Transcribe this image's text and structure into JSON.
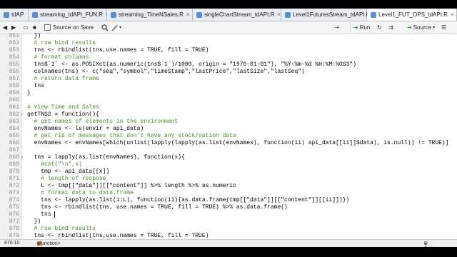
{
  "tabs": [
    {
      "label": "tdAPI.R",
      "active": false
    },
    {
      "label": "streaming_tdAPI_FUN.R",
      "active": false
    },
    {
      "label": "streaming_TimeNSales.R",
      "active": false
    },
    {
      "label": "singleChartStream_tdAPI.R",
      "active": false
    },
    {
      "label": "Level1FuturesStream_tdAPI.R",
      "active": false
    },
    {
      "label": "Level1_FUT_OPS_tdAPI.R",
      "active": true
    }
  ],
  "toolbar": {
    "source_on_save": "Source on Save",
    "run": "Run",
    "source": "Source"
  },
  "editor": {
    "lines": [
      {
        "num": "851",
        "text": "  })"
      },
      {
        "num": "852",
        "text": "  # row bind results"
      },
      {
        "num": "853",
        "text": "  tns <- rbindlist(tns,use.names = TRUE, fill = TRUE)"
      },
      {
        "num": "854",
        "text": "  # format columns"
      },
      {
        "num": "855",
        "text": "  tns$`1` <- as.POSIXct(as.numeric(tns$`1`)/1000, origin = \"1970-01-01\"), \"%Y-%m-%d %H:%M:%OS3\")"
      },
      {
        "num": "856",
        "text": "  colnames(tns) <- c(\"seq\",\"symbol\",\"timeStamp\",\"lastPrice\",\"lastSize\",\"lastSeq\")"
      },
      {
        "num": "857",
        "text": "  # return data frame"
      },
      {
        "num": "858",
        "text": "  tns"
      },
      {
        "num": "859",
        "text": "}"
      },
      {
        "num": "860",
        "text": ""
      },
      {
        "num": "861",
        "text": "# View Time and Sales"
      },
      {
        "num": "862",
        "text": "getTNS2 = function(){"
      },
      {
        "num": "863",
        "text": "  # get names of elements in the environment"
      },
      {
        "num": "864",
        "text": "  envNames <- ls(envir = api_data)"
      },
      {
        "num": "865",
        "text": "  # get rid of messages that don't have any stock/option data"
      },
      {
        "num": "866",
        "text": "  envNames <- envNames[which(unlist(lapply(lapply(as.list(envNames), function(ii) api_data[[ii]]$data), is.null)) != TRUE)]"
      },
      {
        "num": "867",
        "text": ""
      },
      {
        "num": "868",
        "text": "  tns = lapply(as.list(envNames), function(x){"
      },
      {
        "num": "869",
        "text": "    #cat(\"\\n\",x)"
      },
      {
        "num": "870",
        "text": "    tmp <- api_data[[x]]"
      },
      {
        "num": "871",
        "text": "    # length of respose"
      },
      {
        "num": "872",
        "text": "    L <- tmp[[\"data\"]][[\"content\"]] %>% length %>% as.numeric"
      },
      {
        "num": "873",
        "text": "    # format data to data.frame"
      },
      {
        "num": "874",
        "text": "    tns <- lapply(as.list(1:L), function(ii){as.data.frame(tmp[[\"data\"]][[\"content\"]][[ii]])})"
      },
      {
        "num": "875",
        "text": "    tns <- rbindlist(tns, use.names = TRUE, fill = TRUE) %>% as.data.frame()"
      },
      {
        "num": "876",
        "text": "    tns "
      },
      {
        "num": "877",
        "text": "  })"
      },
      {
        "num": "878",
        "text": "  # row bind results"
      },
      {
        "num": "879",
        "text": "  tns <- rbindlist(tns,use.names = TRUE, fill = TRUE)"
      }
    ]
  },
  "status": {
    "position": "876:10",
    "scope": "<function>(x)",
    "file_type": "R Script"
  }
}
